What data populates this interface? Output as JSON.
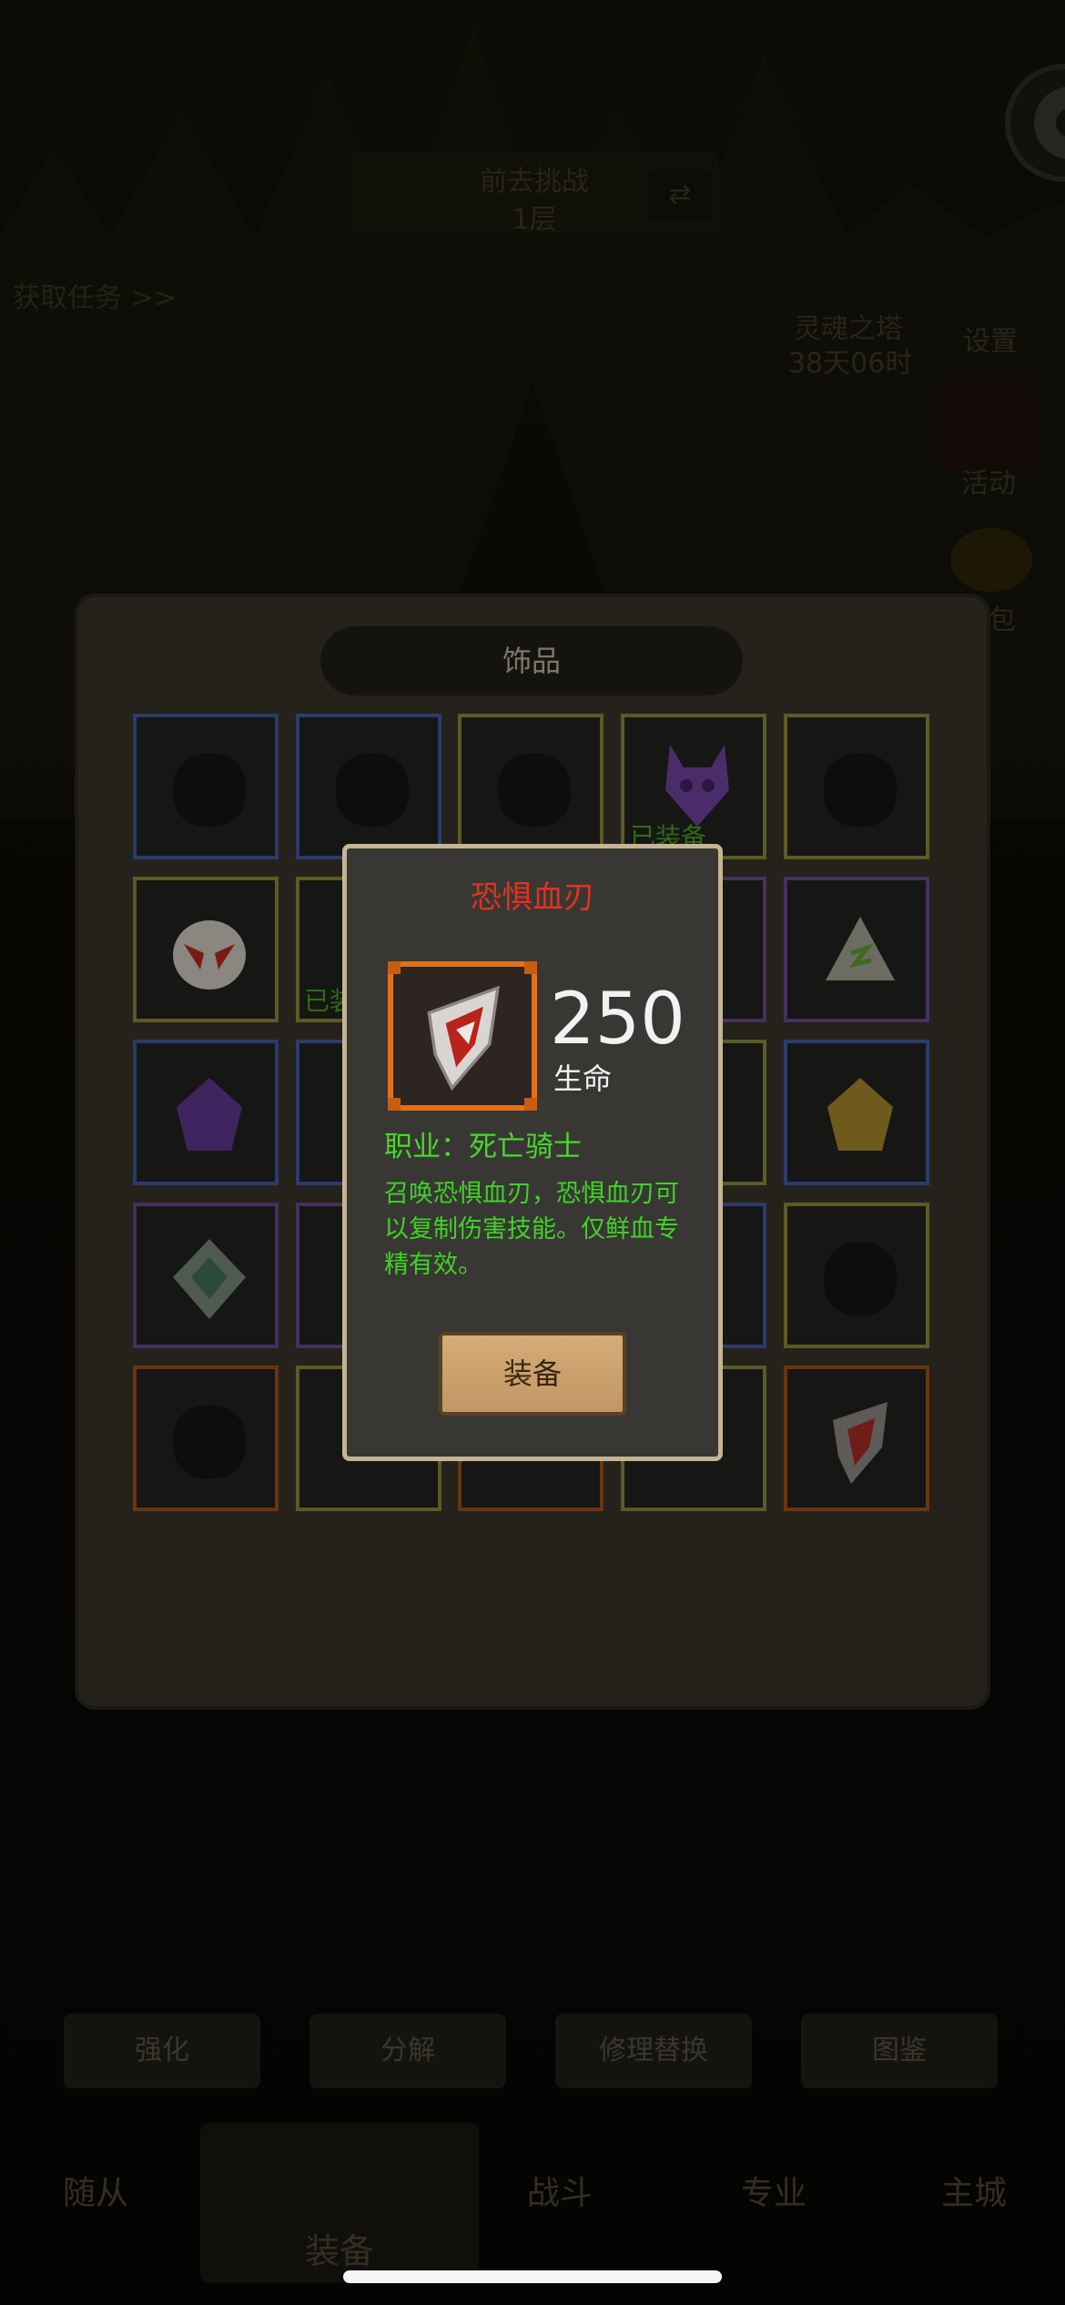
{
  "background": {
    "top_banner": {
      "line1": "前去挑战",
      "line2": "1层"
    },
    "quest_link": "获取任务 >>",
    "tower": {
      "name": "灵魂之塔",
      "timer": "38天06时"
    },
    "side_buttons": [
      "设置",
      "活动"
    ],
    "side_button_3": "包",
    "bottom_buttons": [
      "强化",
      "分解",
      "修理替换",
      "图鉴"
    ],
    "nav": [
      "随从",
      "装备",
      "战斗",
      "专业",
      "主城"
    ]
  },
  "panel": {
    "title": "饰品",
    "equipped_badge": "已装备",
    "equipped_badge_2": "已装"
  },
  "dialog": {
    "item_name": "恐惧血刃",
    "stat_value": "250",
    "stat_label": "生命",
    "class_req": "职业：死亡骑士",
    "description": "召唤恐惧血刃，恐惧血刃可以复制伤害技能。仅鲜血专精有效。",
    "equip_button": "装备"
  },
  "colors": {
    "item_name": "#e3321e",
    "description": "#40d226",
    "dialog_border": "#c4b596",
    "legendary_frame": "#e0701a"
  }
}
